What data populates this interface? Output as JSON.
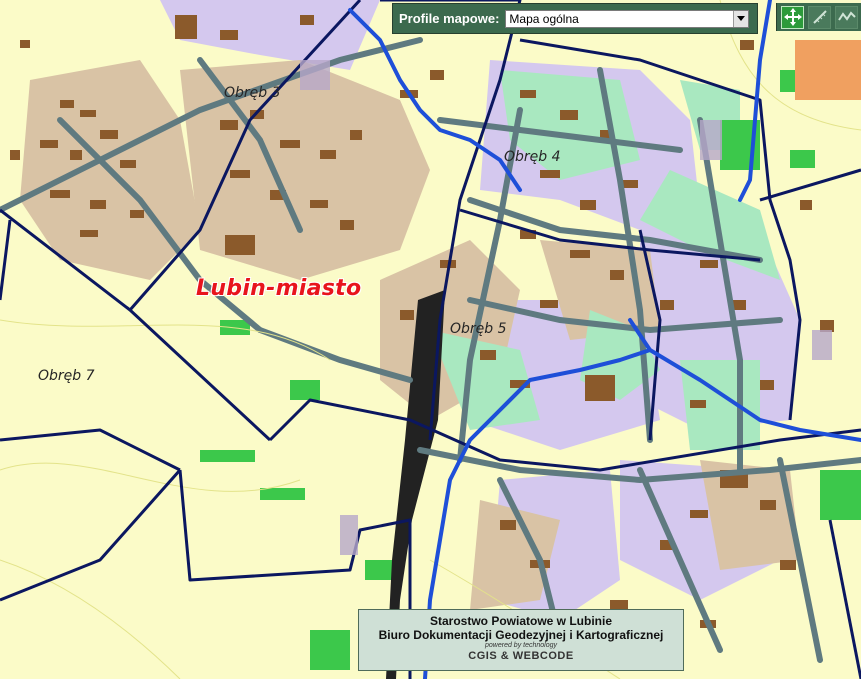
{
  "map": {
    "labels": {
      "obreb3": "Obręb 3",
      "obreb4": "Obręb 4",
      "obreb5": "Obręb 5",
      "obreb7": "Obręb 7",
      "city": "Lubin-miasto"
    },
    "colors": {
      "background": "#fbfbc8",
      "residential": "#d9c3a5",
      "building": "#8b5a2b",
      "road": "#5f7a80",
      "boundary": "#0b1760",
      "river": "#1e4fd8",
      "green": "#3cc84b",
      "park": "#a9e8c0",
      "lilac": "#d4c8ee",
      "city_label": "#e8141c"
    }
  },
  "profile": {
    "label": "Profile mapowe:",
    "selected": "Mapa ogólna"
  },
  "toolbar": {
    "tools": [
      "pan-icon",
      "ruler-icon",
      "measure-path-icon"
    ]
  },
  "footer": {
    "line1": "Starostwo Powiatowe w Lubinie",
    "line2": "Biuro Dokumentacji Geodezyjnej i Kartograficznej",
    "powered": "powered by technology",
    "logo": "CGIS & WEBCODE"
  }
}
